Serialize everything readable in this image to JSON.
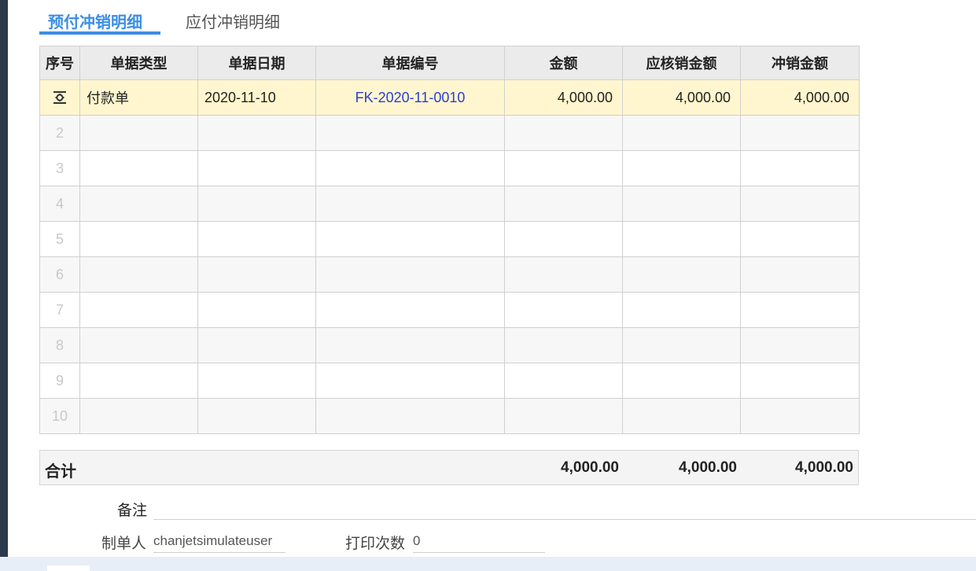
{
  "tabs": [
    {
      "label": "预付冲销明细",
      "active": true
    },
    {
      "label": "应付冲销明细",
      "active": false
    }
  ],
  "table": {
    "headers": {
      "index": "序号",
      "doc_type": "单据类型",
      "doc_date": "单据日期",
      "doc_no": "单据编号",
      "amount": "金额",
      "due_amount": "应核销金额",
      "writeoff_amount": "冲销金额"
    },
    "rows": [
      {
        "index": "",
        "doc_type": "付款单",
        "doc_date": "2020-11-10",
        "doc_no": "FK-2020-11-0010",
        "amount": "4,000.00",
        "due_amount": "4,000.00",
        "writeoff_amount": "4,000.00"
      },
      {
        "index": "2",
        "doc_type": "",
        "doc_date": "",
        "doc_no": "",
        "amount": "",
        "due_amount": "",
        "writeoff_amount": ""
      },
      {
        "index": "3",
        "doc_type": "",
        "doc_date": "",
        "doc_no": "",
        "amount": "",
        "due_amount": "",
        "writeoff_amount": ""
      },
      {
        "index": "4",
        "doc_type": "",
        "doc_date": "",
        "doc_no": "",
        "amount": "",
        "due_amount": "",
        "writeoff_amount": ""
      },
      {
        "index": "5",
        "doc_type": "",
        "doc_date": "",
        "doc_no": "",
        "amount": "",
        "due_amount": "",
        "writeoff_amount": ""
      },
      {
        "index": "6",
        "doc_type": "",
        "doc_date": "",
        "doc_no": "",
        "amount": "",
        "due_amount": "",
        "writeoff_amount": ""
      },
      {
        "index": "7",
        "doc_type": "",
        "doc_date": "",
        "doc_no": "",
        "amount": "",
        "due_amount": "",
        "writeoff_amount": ""
      },
      {
        "index": "8",
        "doc_type": "",
        "doc_date": "",
        "doc_no": "",
        "amount": "",
        "due_amount": "",
        "writeoff_amount": ""
      },
      {
        "index": "9",
        "doc_type": "",
        "doc_date": "",
        "doc_no": "",
        "amount": "",
        "due_amount": "",
        "writeoff_amount": ""
      },
      {
        "index": "10",
        "doc_type": "",
        "doc_date": "",
        "doc_no": "",
        "amount": "",
        "due_amount": "",
        "writeoff_amount": ""
      }
    ],
    "row_action_icon": "gear-icon"
  },
  "totals": {
    "label": "合计",
    "amount": "4,000.00",
    "due_amount": "4,000.00",
    "writeoff_amount": "4,000.00"
  },
  "form": {
    "remark_label": "备注",
    "remark_value": "",
    "maker_label": "制单人",
    "maker_value": "chanjetsimulateuser",
    "print_count_label": "打印次数",
    "print_count_value": "0"
  },
  "colors": {
    "accent": "#3a8ee6",
    "link": "#2b3fd1",
    "active_row": "#fff6cf",
    "header_bg": "#ebebeb",
    "sidebar": "#2d3a4b"
  }
}
